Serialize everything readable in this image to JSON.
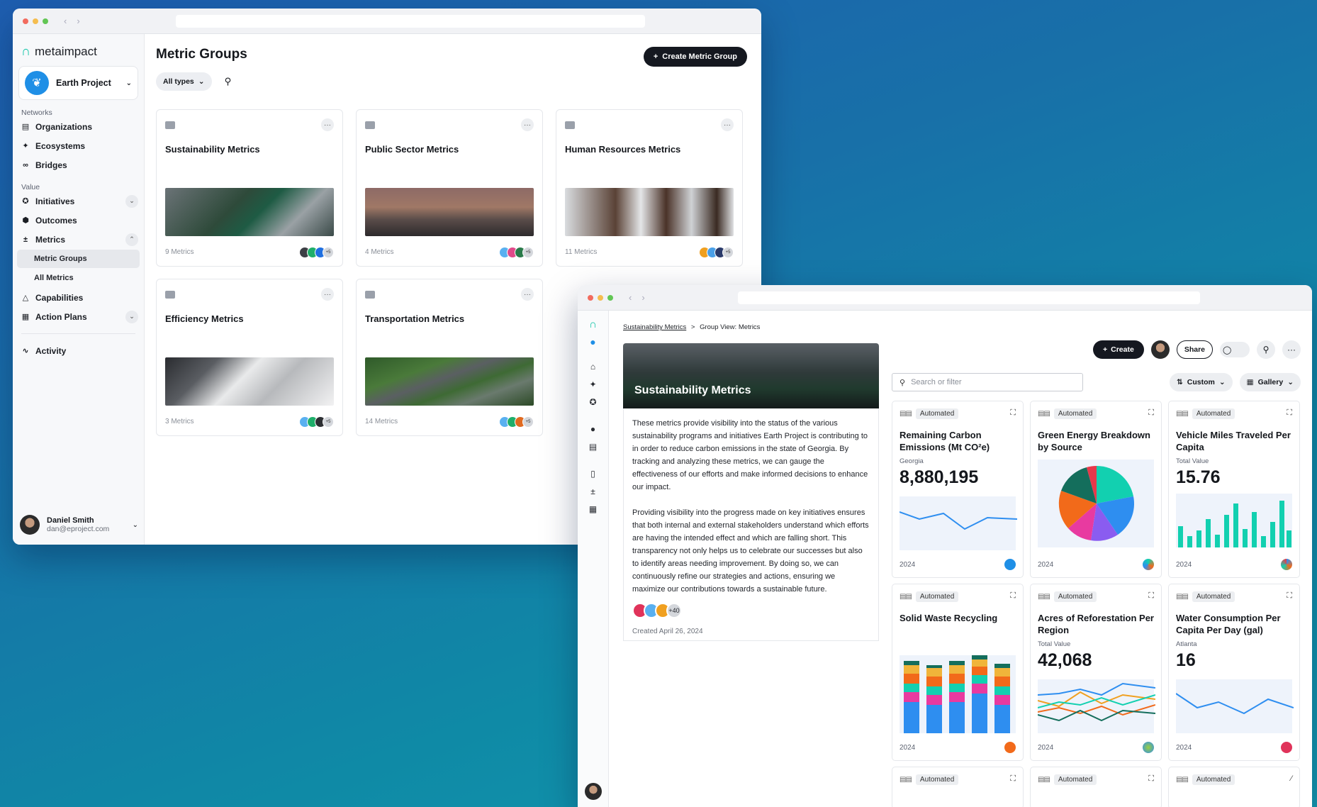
{
  "colors": {
    "accent": "#151820",
    "brand": "#1f8fe6",
    "teal": "#12d0b0",
    "blue": "#2e8ef0"
  },
  "window1": {
    "brand": "metaimpact",
    "project": "Earth Project",
    "sections": {
      "networks": "Networks",
      "value": "Value"
    },
    "nav": {
      "organizations": "Organizations",
      "ecosystems": "Ecosystems",
      "bridges": "Bridges",
      "initiatives": "Initiatives",
      "outcomes": "Outcomes",
      "metrics": "Metrics",
      "metric_groups": "Metric Groups",
      "all_metrics": "All Metrics",
      "capabilities": "Capabilities",
      "action_plans": "Action Plans",
      "activity": "Activity"
    },
    "user": {
      "name": "Daniel Smith",
      "email": "dan@eproject.com"
    },
    "title": "Metric Groups",
    "create_label": "Create Metric Group",
    "filter_label": "All types",
    "groups": [
      {
        "title": "Sustainability Metrics",
        "count": "9 Metrics"
      },
      {
        "title": "Public Sector Metrics",
        "count": "4 Metrics"
      },
      {
        "title": "Human Resources Metrics",
        "count": "11 Metrics"
      },
      {
        "title": "Efficiency Metrics",
        "count": "3 Metrics"
      },
      {
        "title": "Transportation Metrics",
        "count": "14 Metrics"
      }
    ],
    "more_badge": "+5"
  },
  "window2": {
    "breadcrumb": {
      "parent": "Sustainability Metrics",
      "sep": ">",
      "current": "Group View: Metrics"
    },
    "hero_title": "Sustainability Metrics",
    "description": [
      "These metrics provide visibility into the status of the various sustainability programs and initiatives Earth Project is contributing to in order to reduce carbon emissions in the state of Georgia. By tracking and analyzing these metrics, we can gauge the effectiveness of our efforts and make informed decisions to enhance our impact.",
      "Providing visibility into the progress made on key initiatives ensures that both internal and external stakeholders understand which efforts are having the intended effect and which are falling short. This transparency not only helps us to celebrate our successes but also to identify areas needing improvement. By doing so, we can continuously refine our strategies and actions, ensuring we maximize our contributions towards a sustainable future."
    ],
    "members_more": "+40",
    "created": "Created April 26, 2024",
    "create_label": "Create",
    "share_label": "Share",
    "search_placeholder": "Search or filter",
    "sort_label": "Custom",
    "view_label": "Gallery",
    "metrics": [
      {
        "tag": "Automated",
        "title": "Remaining Carbon Emissions (Mt CO²e)",
        "label": "Georgia",
        "value": "8,880,195",
        "year": "2024",
        "viz": "line"
      },
      {
        "tag": "Automated",
        "title": "Green Energy Breakdown by Source",
        "label": "",
        "value": "",
        "year": "2024",
        "viz": "pie"
      },
      {
        "tag": "Automated",
        "title": "Vehicle Miles Traveled Per Capita",
        "label": "Total Value",
        "value": "15.76",
        "year": "2024",
        "viz": "bar"
      },
      {
        "tag": "Automated",
        "title": "Solid Waste Recycling",
        "label": "",
        "value": "",
        "year": "2024",
        "viz": "stack"
      },
      {
        "tag": "Automated",
        "title": "Acres of Reforestation Per Region",
        "label": "Total Value",
        "value": "42,068",
        "year": "2024",
        "viz": "multiline"
      },
      {
        "tag": "Automated",
        "title": "Water Consumption  Per Capita Per Day (gal)",
        "label": "Atlanta",
        "value": "16",
        "year": "2024",
        "viz": "line2"
      },
      {
        "tag": "Automated",
        "title": "",
        "label": "",
        "value": "",
        "year": "",
        "viz": ""
      },
      {
        "tag": "Automated",
        "title": "",
        "label": "",
        "value": "",
        "year": "",
        "viz": ""
      },
      {
        "tag": "Automated",
        "title": "",
        "label": "",
        "value": "",
        "year": "",
        "viz": ""
      }
    ]
  }
}
